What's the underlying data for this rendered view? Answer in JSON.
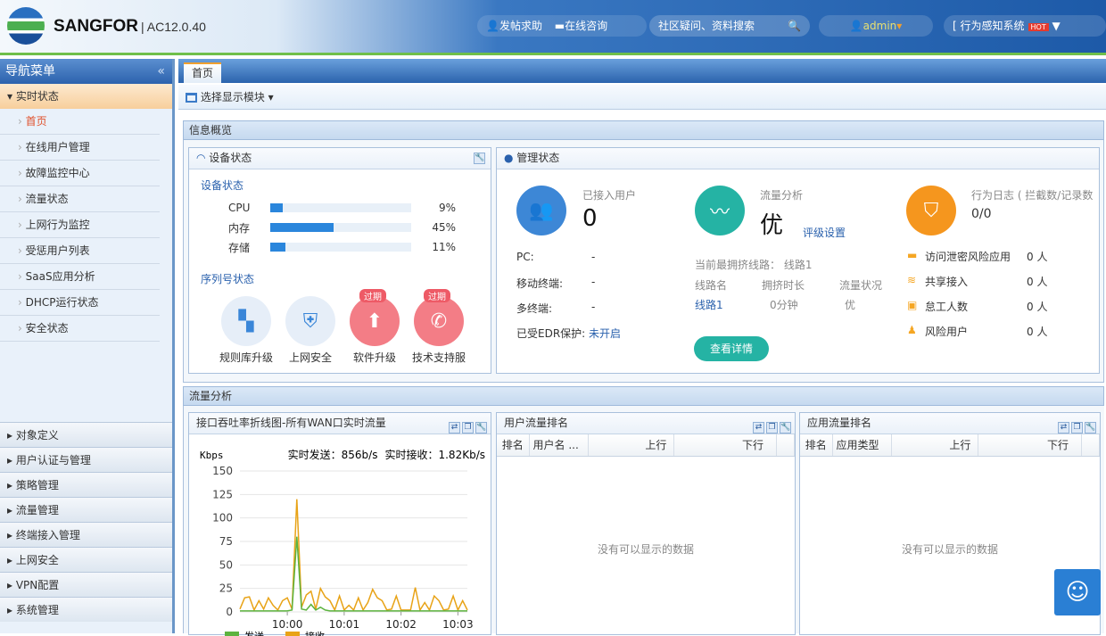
{
  "header": {
    "brand": "SANGFOR",
    "version": "| AC12.0.40",
    "post_help": "发帖求助",
    "online_consult": "在线咨询",
    "search_placeholder": "社区疑问、资料搜索",
    "user": "admin",
    "system": "[ 行为感知系统",
    "hot_badge": "HOT"
  },
  "sidebar": {
    "title": "导航菜单",
    "collapse": "«",
    "section": "实时状态",
    "items": [
      {
        "label": "首页",
        "active": true
      },
      {
        "label": "在线用户管理"
      },
      {
        "label": "故障监控中心"
      },
      {
        "label": "流量状态"
      },
      {
        "label": "上网行为监控"
      },
      {
        "label": "受惩用户列表"
      },
      {
        "label": "SaaS应用分析"
      },
      {
        "label": "DHCP运行状态"
      },
      {
        "label": "安全状态"
      }
    ],
    "groups": [
      "对象定义",
      "用户认证与管理",
      "策略管理",
      "流量管理",
      "终端接入管理",
      "上网安全",
      "VPN配置",
      "系统管理"
    ]
  },
  "tabs": [
    {
      "label": "首页"
    }
  ],
  "toolbar": {
    "select_module": "选择显示模块"
  },
  "info": {
    "title": "信息概览",
    "device": {
      "title": "设备状态",
      "subtitle": "设备状态",
      "metrics": [
        {
          "name": "CPU",
          "value": 9,
          "label": "9%"
        },
        {
          "name": "内存",
          "value": 45,
          "label": "45%"
        },
        {
          "name": "存储",
          "value": 11,
          "label": "11%"
        }
      ],
      "serial_title": "序列号状态",
      "serials": [
        {
          "label": "规则库升级",
          "icon": "grid-icon",
          "expired": ""
        },
        {
          "label": "上网安全",
          "icon": "shield-icon",
          "expired": ""
        },
        {
          "label": "软件升级",
          "icon": "upgrade-icon",
          "expired": "过期"
        },
        {
          "label": "技术支持服",
          "icon": "phone-icon",
          "expired": "过期"
        }
      ]
    },
    "manage": {
      "title": "管理状态",
      "users": {
        "title": "已接入用户",
        "value": "0",
        "rows": [
          {
            "k": "PC:",
            "v": "-"
          },
          {
            "k": "移动终端:",
            "v": "-"
          },
          {
            "k": "多终端:",
            "v": "-"
          }
        ],
        "edr_label": "已受EDR保护:",
        "edr_value": "未开启"
      },
      "traffic": {
        "title": "流量分析",
        "value": "优",
        "link": "评级设置",
        "congest_label": "当前最拥挤线路：",
        "congest_value": "线路1",
        "cols": [
          "线路名",
          "拥挤时长",
          "流量状况"
        ],
        "row": [
          "线路1",
          "0分钟",
          "优"
        ],
        "button": "查看详情"
      },
      "behavior": {
        "title": "行为日志 ( 拦截数/记录数",
        "value": "0/0",
        "rows": [
          {
            "k": "访问泄密风险应用",
            "v": "0 人"
          },
          {
            "k": "共享接入",
            "v": "0 人"
          },
          {
            "k": "怠工人数",
            "v": "0 人"
          },
          {
            "k": "风险用户",
            "v": "0 人"
          }
        ]
      }
    }
  },
  "traffic": {
    "title": "流量分析",
    "throughput": {
      "title": "接口吞吐率折线图-所有WAN口实时流量",
      "unit": "Kbps",
      "send_rt": "实时发送：856b/s",
      "recv_rt": "实时接收：1.82Kb/s"
    },
    "user_rank": {
      "title": "用户流量排名",
      "cols": [
        "排名",
        "用户名 ...",
        "上行",
        "下行"
      ],
      "empty": "没有可以显示的数据"
    },
    "app_rank": {
      "title": "应用流量排名",
      "cols": [
        "排名",
        "应用类型",
        "上行",
        "下行"
      ],
      "empty": "没有可以显示的数据"
    }
  },
  "chart_data": {
    "type": "line",
    "ylabel": "Kbps",
    "ylim": [
      0,
      150
    ],
    "yticks": [
      0,
      25,
      50,
      75,
      100,
      125,
      150
    ],
    "xticks": [
      "10:00",
      "10:01",
      "10:02",
      "10:03"
    ],
    "xrange": [
      "09:59:10",
      "10:03:10"
    ],
    "grid": true,
    "legend_position": "bottom-left",
    "x_step_seconds": 5,
    "series": [
      {
        "name": "发送",
        "color": "#5cb33f",
        "values": [
          1,
          1,
          1,
          1,
          1,
          1,
          1,
          1,
          1,
          1,
          1,
          2,
          80,
          3,
          2,
          8,
          2,
          5,
          2,
          1,
          1,
          1,
          1,
          1,
          1,
          1,
          1,
          1,
          1,
          1,
          1,
          1,
          1,
          1,
          1,
          1,
          1,
          1,
          1,
          1,
          1,
          1,
          1,
          1,
          1,
          1,
          1,
          1,
          1
        ]
      },
      {
        "name": "接收",
        "color": "#e8a317",
        "values": [
          3,
          15,
          16,
          2,
          12,
          3,
          15,
          7,
          2,
          12,
          15,
          3,
          120,
          5,
          18,
          22,
          3,
          25,
          16,
          12,
          2,
          17,
          2,
          7,
          2,
          15,
          2,
          10,
          24,
          15,
          12,
          2,
          3,
          17,
          2,
          2,
          2,
          26,
          2,
          10,
          2,
          17,
          12,
          2,
          3,
          17,
          2,
          12,
          2
        ]
      }
    ]
  }
}
